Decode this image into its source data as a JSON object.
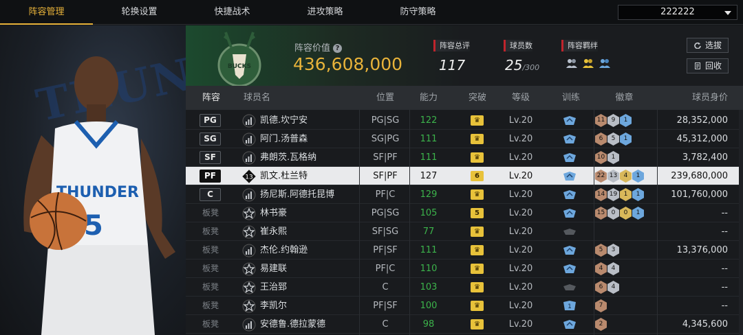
{
  "nav": {
    "tabs": [
      {
        "label": "阵容管理",
        "active": true
      },
      {
        "label": "轮换设置",
        "active": false
      },
      {
        "label": "快捷战术",
        "active": false
      },
      {
        "label": "进攻策略",
        "active": false
      },
      {
        "label": "防守策略",
        "active": false
      }
    ],
    "team_selector": "222222"
  },
  "portrait": {
    "bg_text": "THUNDER",
    "jersey_text": "THUNDER",
    "jersey_number": "5"
  },
  "header": {
    "logo_text": "BUCKS",
    "lineup_value_label": "阵容价值",
    "lineup_value": "436,608,000",
    "rating_label": "阵容总评",
    "rating": "117",
    "players_label": "球员数",
    "players": "25",
    "players_max": "/300",
    "bonds_label": "阵容羁绊",
    "pick_button": "选拔",
    "recycle_button": "回收"
  },
  "table": {
    "columns": [
      "阵容",
      "球员名",
      "位置",
      "能力",
      "突破",
      "等级",
      "训练",
      "徽章",
      "球员身价"
    ],
    "rows": [
      {
        "slot": "PG",
        "starter": true,
        "tier": "bars",
        "name": "凯德.坎宁安",
        "pos": "PG|SG",
        "ability": "122",
        "break": "crown",
        "level": "Lv.20",
        "train": "blue",
        "badges": [
          [
            "br",
            "11"
          ],
          [
            "si",
            "9"
          ],
          [
            "bl",
            "1"
          ]
        ],
        "value": "28,352,000",
        "selected": false
      },
      {
        "slot": "SG",
        "starter": true,
        "tier": "bars",
        "name": "阿门.汤普森",
        "pos": "SG|PG",
        "ability": "111",
        "break": "crown",
        "level": "Lv.20",
        "train": "blue",
        "badges": [
          [
            "br",
            "6"
          ],
          [
            "si",
            "5"
          ],
          [
            "bl",
            "1"
          ]
        ],
        "value": "45,312,000",
        "selected": false
      },
      {
        "slot": "SF",
        "starter": true,
        "tier": "bars",
        "name": "弗朗茨.瓦格纳",
        "pos": "SF|PF",
        "ability": "111",
        "break": "crown",
        "level": "Lv.20",
        "train": "blue",
        "badges": [
          [
            "br",
            "10"
          ],
          [
            "si",
            "1"
          ]
        ],
        "value": "3,782,400",
        "selected": false
      },
      {
        "slot": "PF",
        "starter": true,
        "tier": "13",
        "name": "凯文.杜兰特",
        "pos": "SF|PF",
        "ability": "127",
        "break": "6",
        "level": "Lv.20",
        "train": "blue",
        "badges": [
          [
            "br",
            "22"
          ],
          [
            "si",
            "13"
          ],
          [
            "go",
            "4"
          ],
          [
            "bl",
            "1"
          ]
        ],
        "value": "239,680,000",
        "selected": true
      },
      {
        "slot": "C",
        "starter": true,
        "tier": "bars",
        "name": "扬尼斯.阿德托昆博",
        "pos": "PF|C",
        "ability": "129",
        "break": "crown",
        "level": "Lv.20",
        "train": "blue",
        "badges": [
          [
            "br",
            "14"
          ],
          [
            "si",
            "19"
          ],
          [
            "go",
            "1"
          ],
          [
            "bl",
            "1"
          ]
        ],
        "value": "101,760,000",
        "selected": false
      },
      {
        "slot": "板凳",
        "starter": false,
        "tier": "star",
        "name": "林书豪",
        "pos": "PG|SG",
        "ability": "105",
        "break": "5",
        "level": "Lv.20",
        "train": "blue",
        "badges": [
          [
            "br",
            "15"
          ],
          [
            "si",
            "0"
          ],
          [
            "go",
            "0"
          ],
          [
            "bl",
            "1"
          ]
        ],
        "value": "--",
        "selected": false
      },
      {
        "slot": "板凳",
        "starter": false,
        "tier": "star",
        "name": "崔永熙",
        "pos": "SF|SG",
        "ability": "77",
        "break": "crown",
        "level": "Lv.20",
        "train": "grey",
        "badges": [],
        "value": "--",
        "selected": false
      },
      {
        "slot": "板凳",
        "starter": false,
        "tier": "bars",
        "name": "杰伦.约翰逊",
        "pos": "PF|SF",
        "ability": "111",
        "break": "crown",
        "level": "Lv.20",
        "train": "blue",
        "badges": [
          [
            "br",
            "5"
          ],
          [
            "si",
            "3"
          ]
        ],
        "value": "13,376,000",
        "selected": false
      },
      {
        "slot": "板凳",
        "starter": false,
        "tier": "star",
        "name": "易建联",
        "pos": "PF|C",
        "ability": "110",
        "break": "crown",
        "level": "Lv.20",
        "train": "blue",
        "badges": [
          [
            "br",
            "4"
          ],
          [
            "si",
            "4"
          ]
        ],
        "value": "--",
        "selected": false
      },
      {
        "slot": "板凳",
        "starter": false,
        "tier": "star",
        "name": "王治郅",
        "pos": "C",
        "ability": "103",
        "break": "crown",
        "level": "Lv.20",
        "train": "grey",
        "badges": [
          [
            "br",
            "6"
          ],
          [
            "si",
            "4"
          ]
        ],
        "value": "--",
        "selected": false
      },
      {
        "slot": "板凳",
        "starter": false,
        "tier": "star",
        "name": "李凯尔",
        "pos": "PF|SF",
        "ability": "100",
        "break": "crown",
        "level": "Lv.20",
        "train": "blue1",
        "badges": [
          [
            "br",
            "7"
          ]
        ],
        "value": "--",
        "selected": false
      },
      {
        "slot": "板凳",
        "starter": false,
        "tier": "bars",
        "name": "安德鲁.德拉蒙德",
        "pos": "C",
        "ability": "98",
        "break": "crown",
        "level": "Lv.20",
        "train": "blue",
        "badges": [
          [
            "br",
            "2"
          ]
        ],
        "value": "4,345,600",
        "selected": false
      }
    ]
  },
  "colors": {
    "accent": "#e8b33a",
    "ability_green": "#3cb44b",
    "tag_red": "#c0242c"
  }
}
